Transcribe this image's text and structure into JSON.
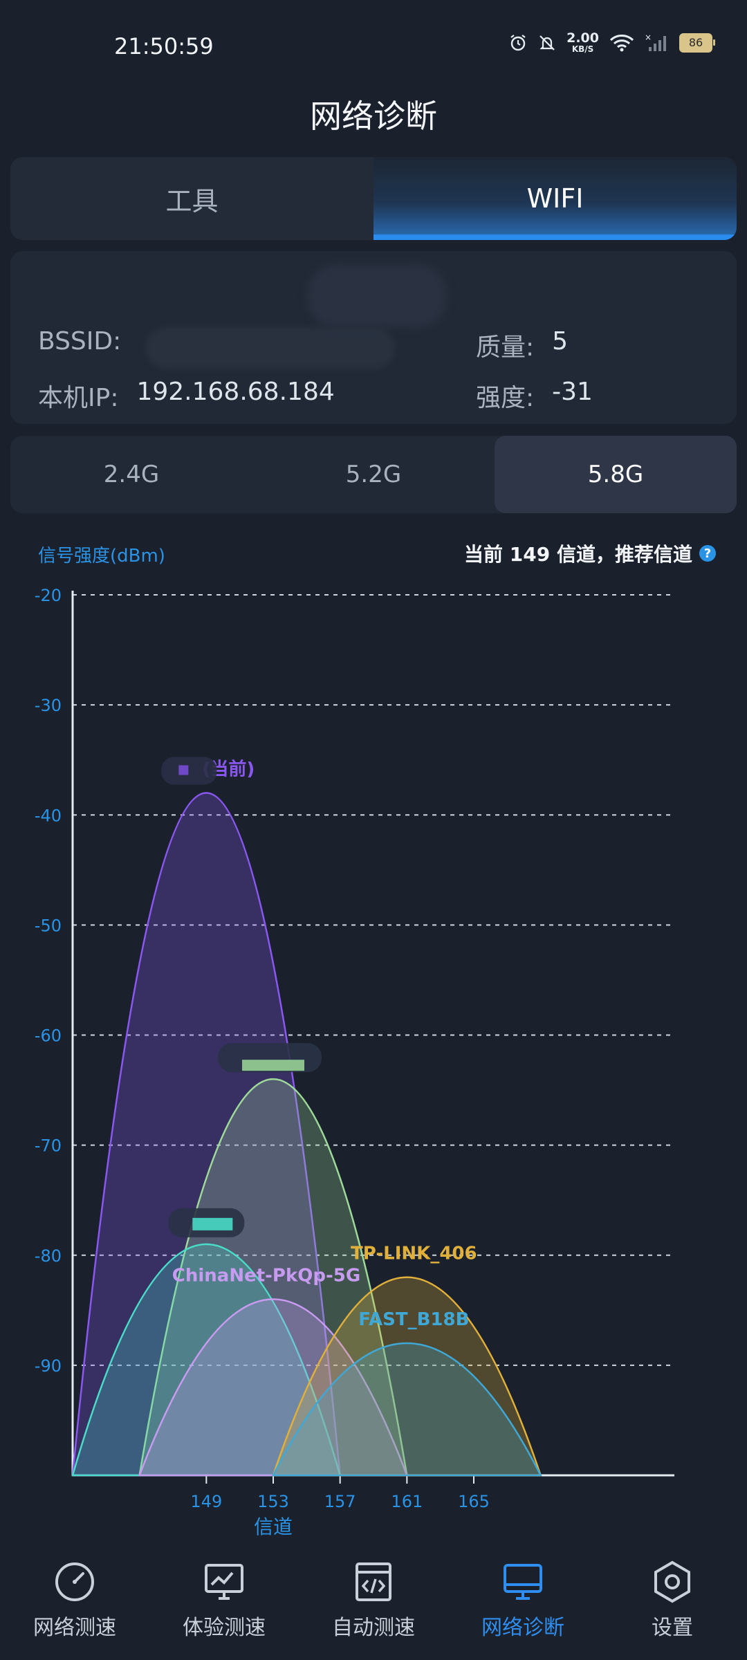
{
  "status_bar": {
    "time": "21:50:59",
    "net_speed": "2.00",
    "net_unit": "KB/S",
    "battery": "86"
  },
  "page_title": "网络诊断",
  "tabs": [
    {
      "label": "工具",
      "active": false
    },
    {
      "label": "WIFI",
      "active": true
    }
  ],
  "wifi_info": {
    "bssid_label": "BSSID:",
    "ip_label": "本机IP:",
    "ip_value": "192.168.68.184",
    "quality_label": "质量:",
    "quality_value": "5",
    "strength_label": "强度:",
    "strength_value": "-31"
  },
  "bands": [
    {
      "label": "2.4G",
      "active": false
    },
    {
      "label": "5.2G",
      "active": false
    },
    {
      "label": "5.8G",
      "active": true
    }
  ],
  "chart_header": {
    "y_label": "信号强度(dBm)",
    "channel_info": "当前 149 信道，推荐信道"
  },
  "chart_data": {
    "type": "area",
    "ylabel": "信号强度(dBm)",
    "xlabel": "信道",
    "y_ticks": [
      -20,
      -30,
      -40,
      -50,
      -60,
      -70,
      -80,
      -90
    ],
    "ylim": [
      -100,
      -20
    ],
    "x_ticks": [
      149,
      153,
      157,
      161,
      165
    ],
    "xlim": [
      141,
      177
    ],
    "grid": true,
    "series": [
      {
        "name": "(当前)",
        "center": 149,
        "width": 8,
        "peak": -38,
        "color": "#8a57f0"
      },
      {
        "center": 153,
        "width": 8,
        "peak": -64,
        "color": "#9ed99a"
      },
      {
        "center": 149,
        "width": 8,
        "peak": -79,
        "color": "#49dcc8"
      },
      {
        "name": "ChinaNet-PkQp-5G",
        "center": 153,
        "width": 8,
        "peak": -84,
        "color": "#c79bf0"
      },
      {
        "name": "TP-LINK_406",
        "center": 161,
        "width": 8,
        "peak": -82,
        "color": "#e0b03a"
      },
      {
        "name": "FAST_B18B",
        "center": 161,
        "width": 8,
        "peak": -88,
        "color": "#3fa8d6"
      }
    ]
  },
  "bottom_nav": [
    {
      "label": "网络测速",
      "icon": "speedometer-icon",
      "active": false
    },
    {
      "label": "体验测速",
      "icon": "monitor-chart-icon",
      "active": false
    },
    {
      "label": "自动测速",
      "icon": "code-window-icon",
      "active": false
    },
    {
      "label": "网络诊断",
      "icon": "desktop-icon",
      "active": true
    },
    {
      "label": "设置",
      "icon": "hexagon-gear-icon",
      "active": false
    }
  ]
}
